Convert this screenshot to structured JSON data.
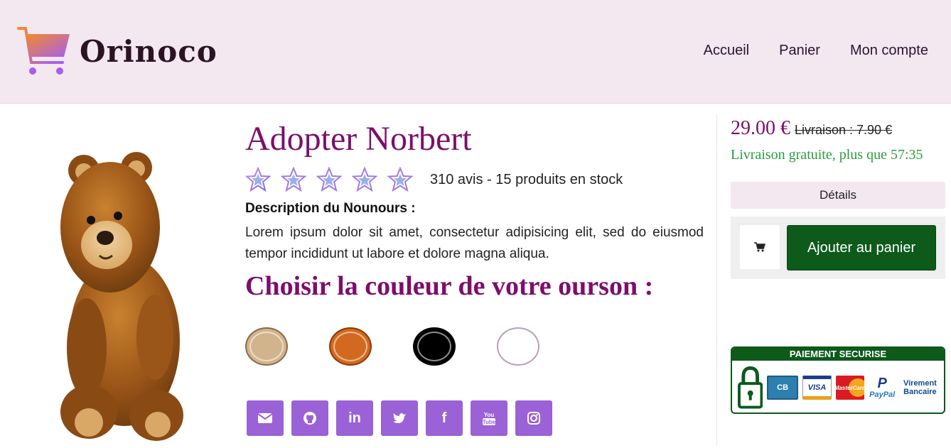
{
  "header": {
    "brand": "Orinoco",
    "nav": [
      "Accueil",
      "Panier",
      "Mon compte"
    ]
  },
  "product": {
    "title": "Adopter Norbert",
    "rating_stars": 5,
    "rating_text": "310 avis - 15 produits en stock",
    "desc_label": "Description du Nounours :",
    "description": "Lorem ipsum dolor sit amet, consectetur adipisicing elit, sed do eiusmod tempor incididunt ut labore et dolore magna aliqua.",
    "choose_color": "Choisir la couleur de votre ourson :",
    "colors": [
      "#d2b48c",
      "#d2691e",
      "#000000",
      "#ffffff"
    ]
  },
  "social": [
    "email-icon",
    "github-icon",
    "linkedin-icon",
    "twitter-icon",
    "facebook-icon",
    "youtube-icon",
    "instagram-icon"
  ],
  "purchase": {
    "price": "29.00 €",
    "old_shipping": "Livraison : 7.90 €",
    "free_shipping": "Livraison gratuite, plus que 57:35",
    "details_label": "Détails",
    "add_to_cart": "Ajouter au panier"
  },
  "secure_payment": {
    "heading": "PAIEMENT SECURISE",
    "cards": [
      "CB",
      "VISA",
      "MasterCard",
      "PayPal",
      "Virement Bancaire"
    ]
  },
  "colors": {
    "accent": "#7d0e6b",
    "header_bg": "#f3e7f0",
    "social_bg": "#9a62d6",
    "cart_btn": "#0d5a1b",
    "free_shipping": "#2a9d3d"
  }
}
